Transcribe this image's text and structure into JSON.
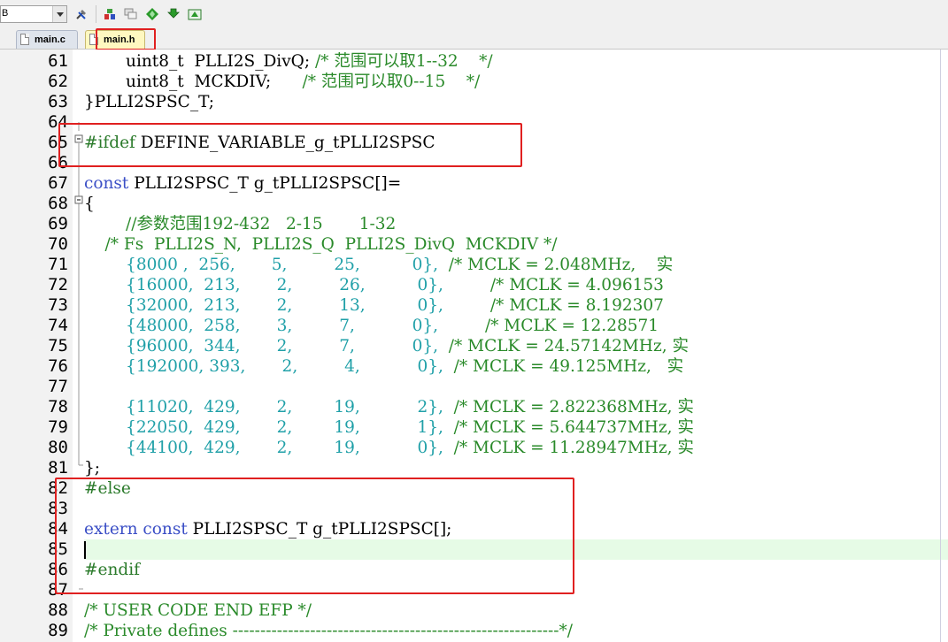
{
  "toolbar": {
    "combo_value": "B",
    "icons": [
      "build-tools-icon",
      "insert-item-icon",
      "stack-windows-icon",
      "green-diamond-icon",
      "download-icon",
      "target-icon"
    ]
  },
  "tabs": [
    {
      "label": "main.c",
      "active": false
    },
    {
      "label": "main.h",
      "active": true
    }
  ],
  "colors": {
    "comment": "#2a8a2a",
    "keyword": "#3b4fc6",
    "preprocessor": "#2a7a2a",
    "number": "#20a0a8",
    "annotation": "#e02020",
    "current_line": "#e6fbe6"
  },
  "editor": {
    "current_line": 85,
    "lines": [
      {
        "n": "61",
        "tokens": [
          [
            "t",
            "        uint8_t  PLLI2S_DivQ; "
          ],
          [
            "c",
            "/* 范围可以取1--32    */"
          ]
        ]
      },
      {
        "n": "62",
        "tokens": [
          [
            "t",
            "        uint8_t  MCKDIV;      "
          ],
          [
            "c",
            "/* 范围可以取0--15    */"
          ]
        ]
      },
      {
        "n": "63",
        "tokens": [
          [
            "t",
            "}PLLI2SPSC_T;"
          ]
        ]
      },
      {
        "n": "64",
        "tokens": []
      },
      {
        "n": "65",
        "tokens": [
          [
            "p",
            "#ifdef"
          ],
          [
            "t",
            " DEFINE_VARIABLE_g_tPLLI2SPSC"
          ]
        ]
      },
      {
        "n": "66",
        "tokens": []
      },
      {
        "n": "67",
        "tokens": [
          [
            "k",
            "const"
          ],
          [
            "t",
            " PLLI2SPSC_T g_tPLLI2SPSC[]="
          ]
        ]
      },
      {
        "n": "68",
        "tokens": [
          [
            "t",
            "{"
          ]
        ]
      },
      {
        "n": "69",
        "tokens": [
          [
            "c",
            "        //参数范围192-432   2-15       1-32"
          ]
        ]
      },
      {
        "n": "70",
        "tokens": [
          [
            "c",
            "    /* Fs  PLLI2S_N,  PLLI2S_Q  PLLI2S_DivQ  MCKDIV */"
          ]
        ]
      },
      {
        "n": "71",
        "tokens": [
          [
            "n",
            "        {8000 ,  256,       5,         25,          0},  "
          ],
          [
            "c",
            "/* MCLK = 2.048MHz,    实"
          ]
        ]
      },
      {
        "n": "72",
        "tokens": [
          [
            "n",
            "        {16000,  213,       2,         26,          0},         "
          ],
          [
            "c",
            "/* MCLK = 4.096153"
          ]
        ]
      },
      {
        "n": "73",
        "tokens": [
          [
            "n",
            "        {32000,  213,       2,         13,          0},         "
          ],
          [
            "c",
            "/* MCLK = 8.192307"
          ]
        ]
      },
      {
        "n": "74",
        "tokens": [
          [
            "n",
            "        {48000,  258,       3,         7,           0},         "
          ],
          [
            "c",
            "/* MCLK = 12.28571"
          ]
        ]
      },
      {
        "n": "75",
        "tokens": [
          [
            "n",
            "        {96000,  344,       2,         7,           0},  "
          ],
          [
            "c",
            "/* MCLK = 24.57142MHz, 实"
          ]
        ]
      },
      {
        "n": "76",
        "tokens": [
          [
            "n",
            "        {192000, 393,       2,         4,           0},  "
          ],
          [
            "c",
            "/* MCLK = 49.125MHz,   实"
          ]
        ]
      },
      {
        "n": "77",
        "tokens": []
      },
      {
        "n": "78",
        "tokens": [
          [
            "n",
            "        {11020,  429,       2,        19,           2},  "
          ],
          [
            "c",
            "/* MCLK = 2.822368MHz, 实"
          ]
        ]
      },
      {
        "n": "79",
        "tokens": [
          [
            "n",
            "        {22050,  429,       2,        19,           1},  "
          ],
          [
            "c",
            "/* MCLK = 5.644737MHz, 实"
          ]
        ]
      },
      {
        "n": "80",
        "tokens": [
          [
            "n",
            "        {44100,  429,       2,        19,           0},  "
          ],
          [
            "c",
            "/* MCLK = 11.28947MHz, 实"
          ]
        ]
      },
      {
        "n": "81",
        "tokens": [
          [
            "t",
            "};"
          ]
        ]
      },
      {
        "n": "82",
        "tokens": [
          [
            "p",
            "#else"
          ]
        ]
      },
      {
        "n": "83",
        "tokens": []
      },
      {
        "n": "84",
        "tokens": [
          [
            "k",
            "extern"
          ],
          [
            "t",
            " "
          ],
          [
            "k",
            "const"
          ],
          [
            "t",
            " PLLI2SPSC_T g_tPLLI2SPSC[];"
          ]
        ]
      },
      {
        "n": "85",
        "tokens": []
      },
      {
        "n": "86",
        "tokens": [
          [
            "p",
            "#endif"
          ]
        ]
      },
      {
        "n": "87",
        "tokens": []
      },
      {
        "n": "88",
        "tokens": [
          [
            "c",
            "/* USER CODE END EFP */"
          ]
        ]
      },
      {
        "n": "89",
        "tokens": [
          [
            "c",
            "/* Private defines -----------------------------------------------------------*/"
          ]
        ]
      }
    ]
  }
}
